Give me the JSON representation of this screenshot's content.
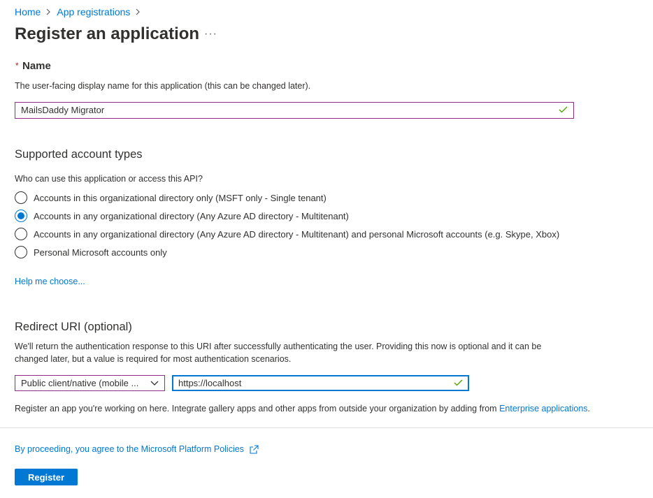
{
  "breadcrumb": {
    "home": "Home",
    "app_registrations": "App registrations"
  },
  "page": {
    "title": "Register an application",
    "more_label": "···"
  },
  "name_section": {
    "label": "Name",
    "required_mark": "*",
    "help": "The user-facing display name for this application (this can be changed later).",
    "value": "MailsDaddy Migrator"
  },
  "account_types": {
    "title": "Supported account types",
    "question": "Who can use this application or access this API?",
    "options": [
      {
        "label": "Accounts in this organizational directory only (MSFT only - Single tenant)",
        "selected": false
      },
      {
        "label": "Accounts in any organizational directory (Any Azure AD directory - Multitenant)",
        "selected": true
      },
      {
        "label": "Accounts in any organizational directory (Any Azure AD directory - Multitenant) and personal Microsoft accounts (e.g. Skype, Xbox)",
        "selected": false
      },
      {
        "label": "Personal Microsoft accounts only",
        "selected": false
      }
    ],
    "help_link": "Help me choose..."
  },
  "redirect": {
    "title": "Redirect URI (optional)",
    "description_line1": "We'll return the authentication response to this URI after successfully authenticating the user. Providing this now is optional and it can be",
    "description_line2": "changed later, but a value is required for most authentication scenarios.",
    "platform_value": "Public client/native (mobile ...",
    "uri_value": "https://localhost",
    "footer_text": "Register an app you're working on here. Integrate gallery apps and other apps from outside your organization by adding from ",
    "footer_link": "Enterprise applications",
    "footer_end": "."
  },
  "policy": {
    "text": "By proceeding, you agree to the Microsoft Platform Policies"
  },
  "actions": {
    "register_label": "Register"
  },
  "colors": {
    "accent": "#0078d4",
    "valid": "#57a300",
    "focus_border": "#8c2d86",
    "required": "#a4262c"
  },
  "icons": {
    "valid": "checkmark-icon",
    "dropdown": "chevron-down-icon",
    "external": "external-link-icon",
    "crumb": "chevron-right-icon"
  }
}
